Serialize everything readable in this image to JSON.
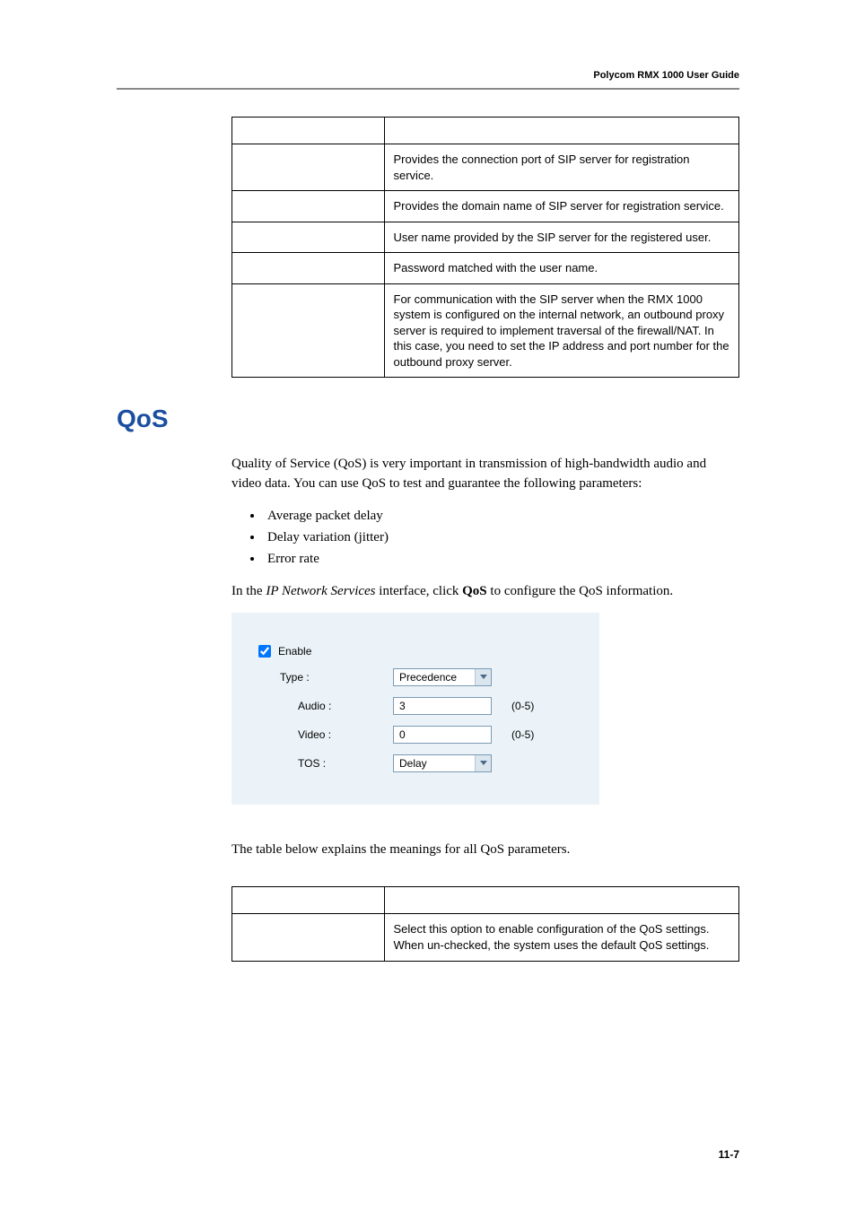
{
  "header": {
    "guide_title": "Polycom RMX 1000 User Guide"
  },
  "table1": {
    "rows": [
      {
        "param": "",
        "desc": "Provides the connection port of SIP server for registration service."
      },
      {
        "param": "",
        "desc": "Provides the domain name of SIP server for registration service."
      },
      {
        "param": "",
        "desc": "User name provided by the SIP server for the registered user."
      },
      {
        "param": "",
        "desc": "Password matched with the user name."
      },
      {
        "param": "",
        "desc": "For communication with the SIP server when the RMX 1000 system is configured on the internal network, an outbound proxy server is required to implement traversal of the firewall/NAT. In this case, you need to set the IP address and port number for the outbound proxy server."
      }
    ]
  },
  "section": {
    "heading": "QoS",
    "para1": "Quality of Service (QoS) is very important in transmission of high-bandwidth audio and video data. You can use QoS to test and guarantee the following parameters:",
    "bullets": [
      "Average packet delay",
      "Delay variation (jitter)",
      "Error rate"
    ],
    "para2_prefix": "In the ",
    "para2_italic": "IP Network Services",
    "para2_mid": " interface, click ",
    "para2_bold": "QoS",
    "para2_suffix": " to configure the QoS information.",
    "table_caption": "The table below explains the meanings for all QoS parameters."
  },
  "qos_panel": {
    "enable_label": "Enable",
    "enable_checked": true,
    "type_label": "Type :",
    "type_value": "Precedence",
    "audio_label": "Audio :",
    "audio_value": "3",
    "audio_range": "(0-5)",
    "video_label": "Video :",
    "video_value": "0",
    "video_range": "(0-5)",
    "tos_label": "TOS :",
    "tos_value": "Delay"
  },
  "table2": {
    "rows": [
      {
        "param": "",
        "desc": "Select this option to enable configuration of the QoS settings. When un-checked, the system uses the default QoS settings."
      }
    ]
  },
  "footer": {
    "page_number": "11-7"
  }
}
